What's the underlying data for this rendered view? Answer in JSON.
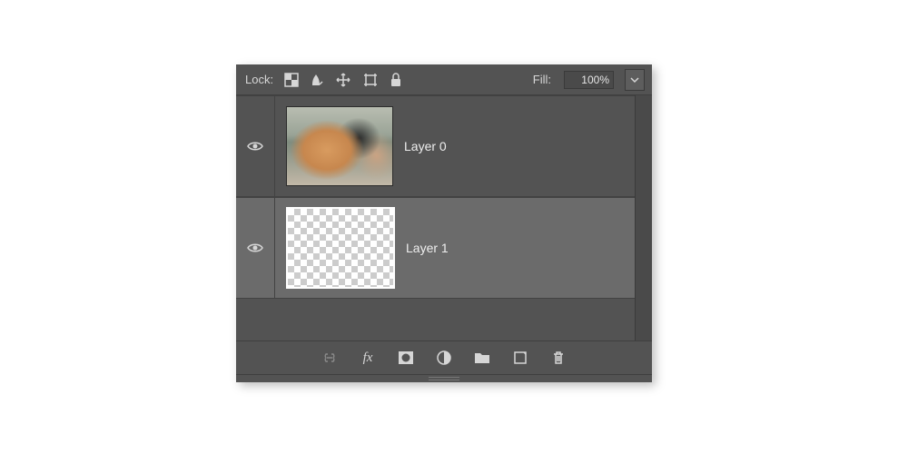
{
  "lockbar": {
    "label": "Lock:",
    "fill_label": "Fill:",
    "fill_value": "100%"
  },
  "icons": {
    "lock_transparent": "transparent-pixels-lock-icon",
    "lock_image": "image-pixels-lock-icon",
    "lock_position": "position-lock-icon",
    "lock_artboard": "artboard-lock-icon",
    "lock_all": "lock-all-icon",
    "link": "link-icon",
    "fx": "fx-icon",
    "mask": "mask-icon",
    "adjust": "adjustment-icon",
    "group": "group-icon",
    "new": "new-layer-icon",
    "trash": "trash-icon",
    "eye": "visibility-icon",
    "chevron": "chevron-down-icon"
  },
  "layers": [
    {
      "name": "Layer 0",
      "selected": false,
      "visible": true,
      "thumb": "photo"
    },
    {
      "name": "Layer 1",
      "selected": true,
      "visible": true,
      "thumb": "transparent"
    }
  ]
}
